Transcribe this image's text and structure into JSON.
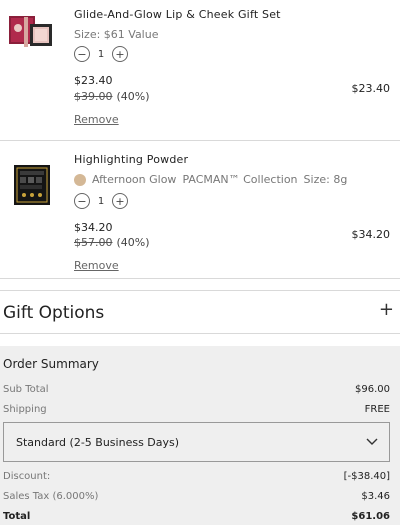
{
  "cart": {
    "items": [
      {
        "name": "Glide-And-Glow Lip & Cheek Gift Set",
        "size_text": "Size: $61 Value",
        "quantity": "1",
        "price": "$23.40",
        "original_price": "$39.00",
        "discount_pct": "(40%)",
        "line_total": "$23.40",
        "remove_label": "Remove"
      },
      {
        "name": "Highlighting Powder",
        "shade": "Afternoon Glow",
        "collection": "PACMAN™ Collection",
        "size_text": "Size: 8g",
        "swatch_color": "#d4b896",
        "quantity": "1",
        "price": "$34.20",
        "original_price": "$57.00",
        "discount_pct": "(40%)",
        "line_total": "$34.20",
        "remove_label": "Remove"
      }
    ]
  },
  "gift_options": {
    "title": "Gift Options",
    "expand_symbol": "+"
  },
  "order_summary": {
    "title": "Order Summary",
    "subtotal_label": "Sub Total",
    "subtotal_value": "$96.00",
    "shipping_label": "Shipping",
    "shipping_value": "FREE",
    "shipping_method": "Standard (2-5 Business Days)",
    "discount_label": "Discount:",
    "discount_value": "[-$38.40]",
    "tax_label": "Sales Tax (6.000%)",
    "tax_value": "$3.46",
    "total_label": "Total",
    "total_value": "$61.06"
  },
  "icons": {
    "minus": "minus-icon",
    "plus": "plus-icon",
    "chevron": "chevron-down-icon"
  }
}
